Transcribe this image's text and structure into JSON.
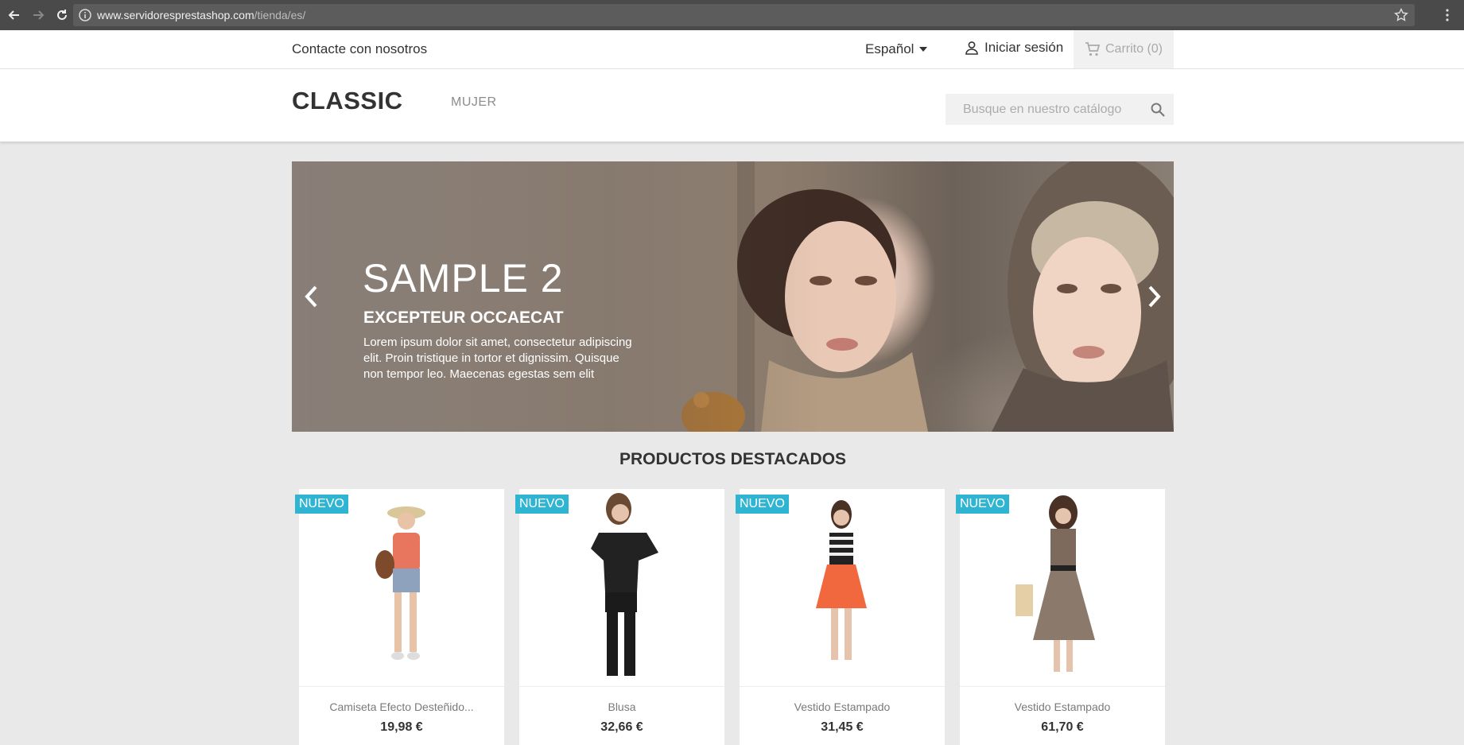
{
  "browser": {
    "url_host": "www.servidoresprestashop.com",
    "url_path": "/tienda/es/"
  },
  "topbar": {
    "contact": "Contacte con nosotros",
    "language": "Español",
    "signin": "Iniciar sesión",
    "cart": "Carrito (0)"
  },
  "header": {
    "logo": "CLASSIC",
    "menu": [
      "MUJER"
    ],
    "search_placeholder": "Busque en nuestro catálogo"
  },
  "hero": {
    "title": "SAMPLE 2",
    "subtitle": "EXCEPTEUR OCCAECAT",
    "description": "Lorem ipsum dolor sit amet, consectetur adipiscing elit. Proin tristique in tortor et dignissim. Quisque non tempor leo. Maecenas egestas sem elit"
  },
  "featured": {
    "title": "PRODUCTOS DESTACADOS",
    "products": [
      {
        "badge": "NUEVO",
        "name": "Camiseta Efecto Desteñido...",
        "price": "19,98 €"
      },
      {
        "badge": "NUEVO",
        "name": "Blusa",
        "price": "32,66 €"
      },
      {
        "badge": "NUEVO",
        "name": "Vestido Estampado",
        "price": "31,45 €"
      },
      {
        "badge": "NUEVO",
        "name": "Vestido Estampado",
        "price": "61,70 €"
      }
    ]
  },
  "colors": {
    "accent_badge": "#2fb5d2",
    "page_bg": "#e9e9e9",
    "browser_bar": "#4a4a4a"
  }
}
